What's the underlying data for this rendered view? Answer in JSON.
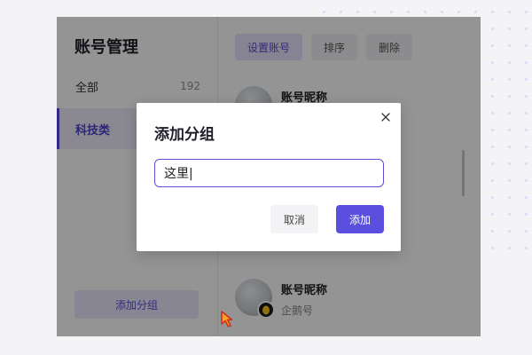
{
  "sidebar": {
    "title": "账号管理",
    "categories": [
      {
        "label": "全部",
        "count": "192"
      },
      {
        "label": "科技类",
        "count": ""
      }
    ],
    "add_group_label": "添加分组"
  },
  "toolbar": {
    "set_account_label": "设置账号",
    "sort_label": "排序",
    "delete_label": "删除"
  },
  "accounts": [
    {
      "name": "账号昵称",
      "sub": ""
    },
    {
      "name": "账号昵称",
      "sub": "企鹅号"
    }
  ],
  "dialog": {
    "title": "添加分组",
    "input_value": "这里|",
    "cancel_label": "取消",
    "confirm_label": "添加"
  },
  "colors": {
    "accent": "#5b4fe0",
    "overlay": "rgba(0,0,0,0.42)"
  }
}
